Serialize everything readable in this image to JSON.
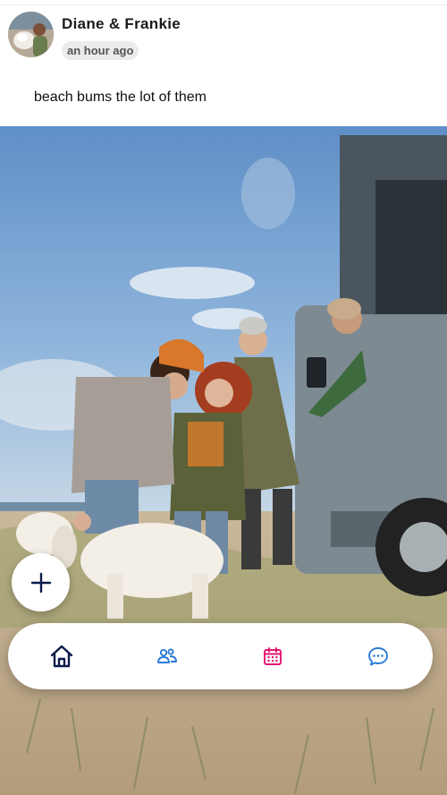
{
  "post": {
    "author": "Diane & Frankie",
    "timestamp": "an hour ago",
    "caption": "beach bums the lot of them"
  },
  "icons": {
    "fab": "plus-icon",
    "tabs": [
      "home-icon",
      "people-icon",
      "calendar-icon",
      "chat-icon"
    ]
  },
  "colors": {
    "home": "#0b1a4a",
    "people": "#2a7bd8",
    "calendar": "#e3166f",
    "chat": "#2a7bd8"
  }
}
